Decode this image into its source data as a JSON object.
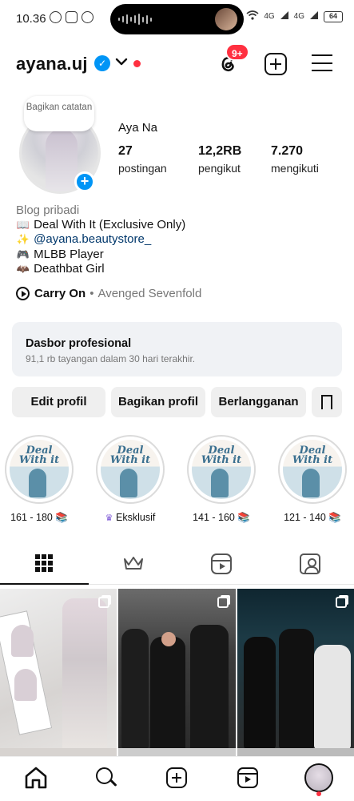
{
  "status_bar": {
    "time": "10.36",
    "network_1": "4G",
    "network_2": "4G",
    "battery": "64"
  },
  "header": {
    "username": "ayana.uj",
    "notification_badge": "9+"
  },
  "profile": {
    "note_text": "Bagikan catatan",
    "display_name": "Aya Na",
    "stats": [
      {
        "value": "27",
        "label": "postingan"
      },
      {
        "value": "12,2RB",
        "label": "pengikut"
      },
      {
        "value": "7.270",
        "label": "mengikuti"
      }
    ],
    "bio": {
      "category": "Blog pribadi",
      "lines": [
        {
          "emoji": "📖",
          "text": "Deal With It (Exclusive Only)"
        },
        {
          "emoji": "✨",
          "text": "@ayana.beautystore_"
        },
        {
          "emoji": "🎮",
          "text": "MLBB Player"
        },
        {
          "emoji": "🦇",
          "text": "Deathbat Girl"
        }
      ]
    },
    "music": {
      "song": "Carry On",
      "separator": "•",
      "artist": "Avenged Sevenfold"
    }
  },
  "dashboard": {
    "title": "Dasbor profesional",
    "subtitle": "91,1 rb tayangan dalam 30 hari terakhir."
  },
  "buttons": {
    "edit": "Edit profil",
    "share": "Bagikan profil",
    "subscribe": "Berlangganan"
  },
  "highlights": [
    {
      "cover_title": "Deal With it",
      "label": "161 - 180 📚"
    },
    {
      "cover_title": "Deal With it",
      "label": "Eksklusif",
      "badge": "♛"
    },
    {
      "cover_title": "Deal With it",
      "label": "141 - 160 📚"
    },
    {
      "cover_title": "Deal With it",
      "label": "121 - 140 📚"
    }
  ],
  "tabs": [
    "grid",
    "exclusive",
    "reels",
    "tagged"
  ],
  "colors": {
    "accent_blue": "#0095f6",
    "badge_red": "#ff3040",
    "button_bg": "#efefef",
    "dashboard_bg": "#f0f2f5",
    "link": "#00376b",
    "exclusive_purple": "#7b55d6"
  }
}
